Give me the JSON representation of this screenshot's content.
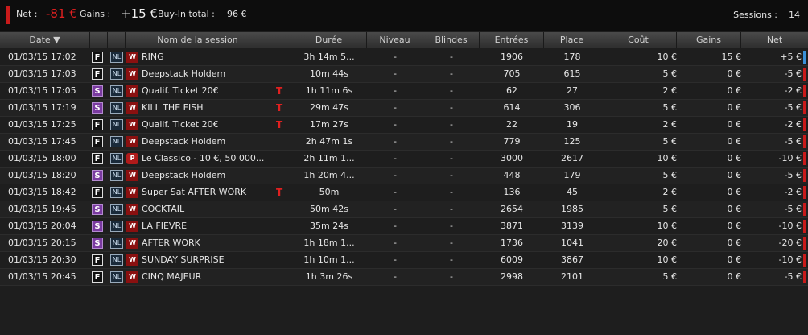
{
  "summary": {
    "net_label": "Net :",
    "net_value": "-81 €",
    "gains_label": "Gains :",
    "gains_value": "+15 €",
    "buyin_label": "Buy-In total :",
    "buyin_value": "96 €",
    "sessions_label": "Sessions :",
    "sessions_value": "14"
  },
  "columns": {
    "date": "Date ▼",
    "name": "Nom de la session",
    "duration": "Durée",
    "level": "Niveau",
    "blinds": "Blindes",
    "entries": "Entrées",
    "place": "Place",
    "cost": "Coût",
    "gains": "Gains",
    "net": "Net"
  },
  "colors": {
    "positive": "#3a8fd8",
    "negative": "#c81a1a",
    "satellite": "#7a3aa0"
  },
  "rows": [
    {
      "date": "01/03/15 17:02",
      "type": "F",
      "nl": "NL",
      "site": "W",
      "name": "RING",
      "ticket": "",
      "dur": "3h 14m 5...",
      "lvl": "-",
      "bl": "-",
      "ent": "1906",
      "pl": "178",
      "cost": "10 €",
      "gain": "15 €",
      "net": "+5 €",
      "pos": true
    },
    {
      "date": "01/03/15 17:03",
      "type": "F",
      "nl": "NL",
      "site": "W",
      "name": "Deepstack Holdem",
      "ticket": "",
      "dur": "10m 44s",
      "lvl": "-",
      "bl": "-",
      "ent": "705",
      "pl": "615",
      "cost": "5 €",
      "gain": "0 €",
      "net": "-5 €",
      "pos": false
    },
    {
      "date": "01/03/15 17:05",
      "type": "S",
      "nl": "NL",
      "site": "W",
      "name": "Qualif. Ticket 20€",
      "ticket": "T",
      "dur": "1h 11m 6s",
      "lvl": "-",
      "bl": "-",
      "ent": "62",
      "pl": "27",
      "cost": "2 €",
      "gain": "0 €",
      "net": "-2 €",
      "pos": false
    },
    {
      "date": "01/03/15 17:19",
      "type": "S",
      "nl": "NL",
      "site": "W",
      "name": "KILL THE FISH",
      "ticket": "T",
      "dur": "29m 47s",
      "lvl": "-",
      "bl": "-",
      "ent": "614",
      "pl": "306",
      "cost": "5 €",
      "gain": "0 €",
      "net": "-5 €",
      "pos": false
    },
    {
      "date": "01/03/15 17:25",
      "type": "F",
      "nl": "NL",
      "site": "W",
      "name": "Qualif. Ticket 20€",
      "ticket": "T",
      "dur": "17m 27s",
      "lvl": "-",
      "bl": "-",
      "ent": "22",
      "pl": "19",
      "cost": "2 €",
      "gain": "0 €",
      "net": "-2 €",
      "pos": false
    },
    {
      "date": "01/03/15 17:45",
      "type": "F",
      "nl": "NL",
      "site": "W",
      "name": "Deepstack Holdem",
      "ticket": "",
      "dur": "2h 47m 1s",
      "lvl": "-",
      "bl": "-",
      "ent": "779",
      "pl": "125",
      "cost": "5 €",
      "gain": "0 €",
      "net": "-5 €",
      "pos": false
    },
    {
      "date": "01/03/15 18:00",
      "type": "F",
      "nl": "NL",
      "site": "P",
      "name": "Le Classico - 10 €, 50 000...",
      "ticket": "",
      "dur": "2h 11m 1...",
      "lvl": "-",
      "bl": "-",
      "ent": "3000",
      "pl": "2617",
      "cost": "10 €",
      "gain": "0 €",
      "net": "-10 €",
      "pos": false
    },
    {
      "date": "01/03/15 18:20",
      "type": "S",
      "nl": "NL",
      "site": "W",
      "name": "Deepstack Holdem",
      "ticket": "",
      "dur": "1h 20m 4...",
      "lvl": "-",
      "bl": "-",
      "ent": "448",
      "pl": "179",
      "cost": "5 €",
      "gain": "0 €",
      "net": "-5 €",
      "pos": false
    },
    {
      "date": "01/03/15 18:42",
      "type": "F",
      "nl": "NL",
      "site": "W",
      "name": "Super Sat AFTER WORK",
      "ticket": "T",
      "dur": "50m",
      "lvl": "-",
      "bl": "-",
      "ent": "136",
      "pl": "45",
      "cost": "2 €",
      "gain": "0 €",
      "net": "-2 €",
      "pos": false
    },
    {
      "date": "01/03/15 19:45",
      "type": "S",
      "nl": "NL",
      "site": "W",
      "name": "COCKTAIL",
      "ticket": "",
      "dur": "50m 42s",
      "lvl": "-",
      "bl": "-",
      "ent": "2654",
      "pl": "1985",
      "cost": "5 €",
      "gain": "0 €",
      "net": "-5 €",
      "pos": false
    },
    {
      "date": "01/03/15 20:04",
      "type": "S",
      "nl": "NL",
      "site": "W",
      "name": "LA FIEVRE",
      "ticket": "",
      "dur": "35m 24s",
      "lvl": "-",
      "bl": "-",
      "ent": "3871",
      "pl": "3139",
      "cost": "10 €",
      "gain": "0 €",
      "net": "-10 €",
      "pos": false
    },
    {
      "date": "01/03/15 20:15",
      "type": "S",
      "nl": "NL",
      "site": "W",
      "name": "AFTER WORK",
      "ticket": "",
      "dur": "1h 18m 1...",
      "lvl": "-",
      "bl": "-",
      "ent": "1736",
      "pl": "1041",
      "cost": "20 €",
      "gain": "0 €",
      "net": "-20 €",
      "pos": false
    },
    {
      "date": "01/03/15 20:30",
      "type": "F",
      "nl": "NL",
      "site": "W",
      "name": "SUNDAY SURPRISE",
      "ticket": "",
      "dur": "1h 10m 1...",
      "lvl": "-",
      "bl": "-",
      "ent": "6009",
      "pl": "3867",
      "cost": "10 €",
      "gain": "0 €",
      "net": "-10 €",
      "pos": false
    },
    {
      "date": "01/03/15 20:45",
      "type": "F",
      "nl": "NL",
      "site": "W",
      "name": "CINQ MAJEUR",
      "ticket": "",
      "dur": "1h 3m 26s",
      "lvl": "-",
      "bl": "-",
      "ent": "2998",
      "pl": "2101",
      "cost": "5 €",
      "gain": "0 €",
      "net": "-5 €",
      "pos": false
    }
  ]
}
